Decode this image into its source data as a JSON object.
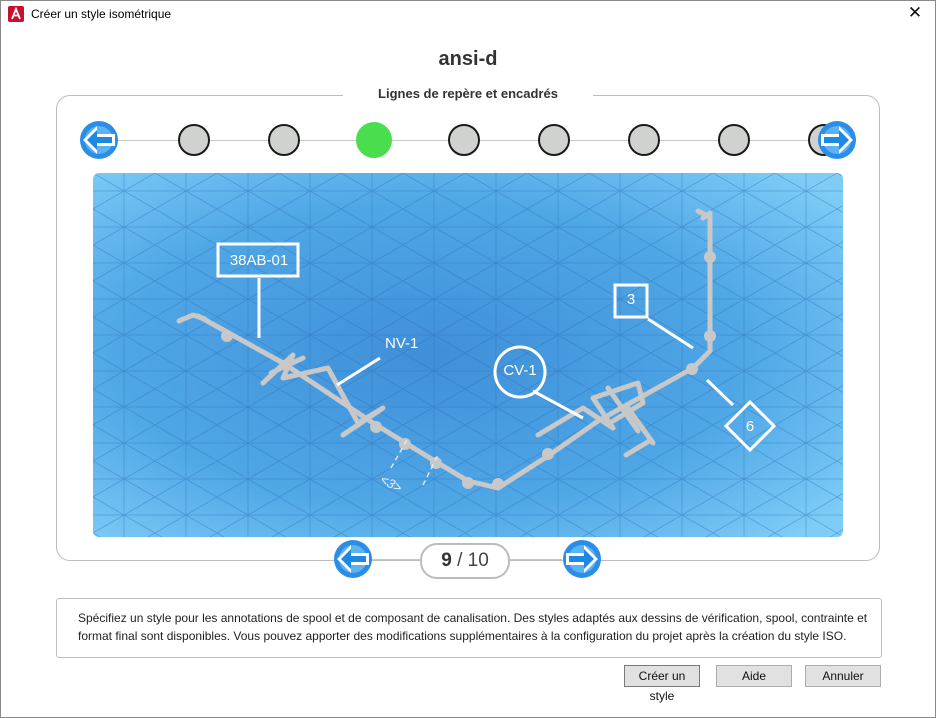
{
  "window": {
    "title": "Créer un style isométrique"
  },
  "style_name": "ansi-d",
  "section_title": "Lignes de repère et encadrés",
  "steps": {
    "count": 8,
    "active_index": 2
  },
  "preview": {
    "labels": {
      "tag1": "38AB-01",
      "tag2": "NV-1",
      "tag3": "CV-1",
      "tag4": "3",
      "tag5": "6",
      "dim": "<3>"
    }
  },
  "pager": {
    "current": "9",
    "separator": "/",
    "total": "10"
  },
  "description": "Spécifiez un style pour les annotations de spool et de composant de canalisation. Des styles adaptés aux dessins de vérification, spool, contrainte et format final sont disponibles. Vous pouvez apporter des modifications supplémentaires à la configuration du projet après la création du style ISO.",
  "buttons": {
    "create": "Créer un style",
    "help": "Aide",
    "cancel": "Annuler"
  },
  "icons": {
    "app": "autocad-icon",
    "close": "close-icon",
    "prev": "arrow-left-icon",
    "next": "arrow-right-icon"
  },
  "colors": {
    "accent": "#1e88e5",
    "active_step": "#4ade4e",
    "inactive_step": "#d0d2d0"
  }
}
